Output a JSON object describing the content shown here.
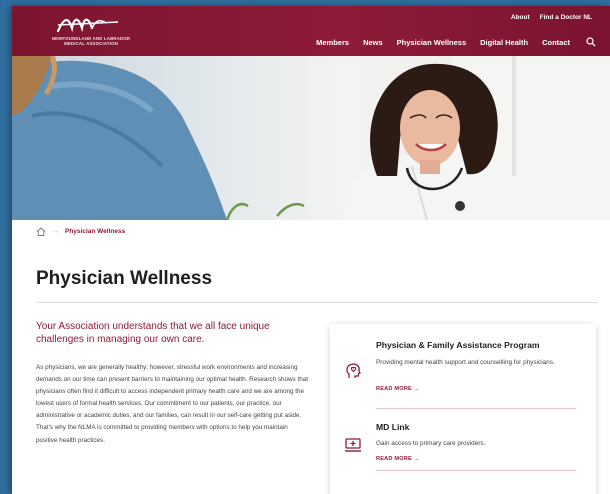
{
  "header": {
    "logo_subtext_line1": "NEWFOUNDLAND AND LABRADOR",
    "logo_subtext_line2": "MEDICAL ASSOCIATION",
    "top_links": [
      "About",
      "Find a Doctor NL"
    ],
    "nav": [
      "Members",
      "News",
      "Physician Wellness",
      "Digital Health",
      "Contact"
    ]
  },
  "breadcrumb": {
    "current": "Physician Wellness"
  },
  "page": {
    "title": "Physician Wellness",
    "intro_heading": "Your Association understands that we all face unique challenges in managing our own care.",
    "intro_body": "As physicians, we are generally healthy; however, stressful work environments and increasing demands on our time can present barriers to maintaining our optimal health. Research shows that physicians often find it difficult to access independent primary health care and we are among the lowest users of formal health services. Our commitment to our patients, our practice, our administrative or academic duties, and our families, can result in our self-care getting put aside. That's why the NLMA is committed to providing members with options to help you maintain positive health practices."
  },
  "resources": [
    {
      "title": "Physician & Family Assistance Program",
      "description": "Providing mental health support and counselling for physicians.",
      "link": "READ MORE →",
      "icon": "head-heart-icon"
    },
    {
      "title": "MD Link",
      "description": "Gain access to primary care providers.",
      "link": "READ MORE →",
      "icon": "medical-monitor-icon"
    }
  ],
  "colors": {
    "brand": "#8e1b38",
    "background_frame": "#2f6e9e"
  }
}
